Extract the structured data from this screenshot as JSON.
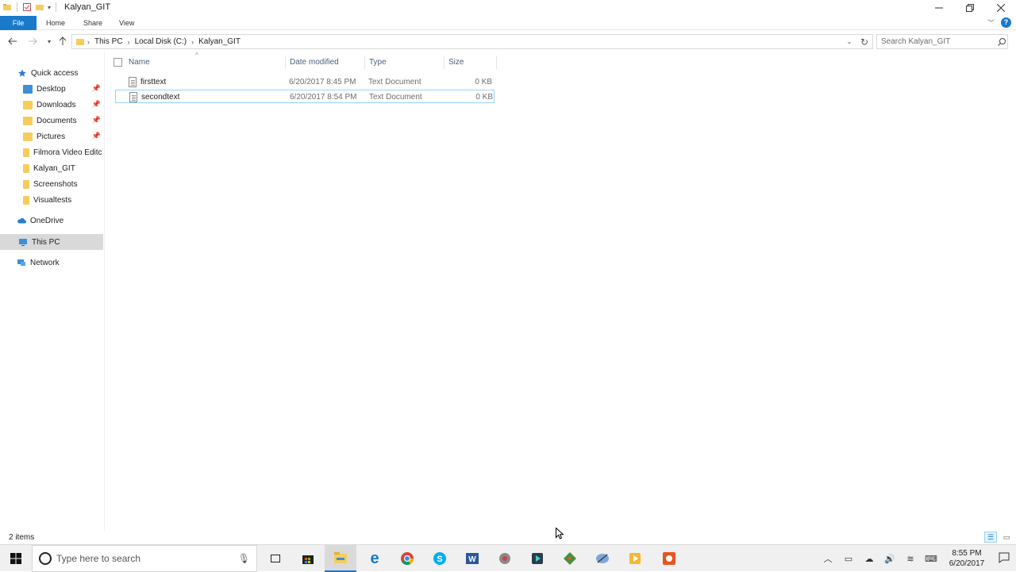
{
  "window": {
    "title": "Kalyan_GIT",
    "controls": [
      "minimize",
      "restore",
      "close"
    ]
  },
  "ribbon": {
    "tabs": [
      "File",
      "Home",
      "Share",
      "View"
    ]
  },
  "address": {
    "crumbs": [
      "This PC",
      "Local Disk (C:)",
      "Kalyan_GIT"
    ],
    "search_placeholder": "Search Kalyan_GIT"
  },
  "nav": {
    "quick_access": "Quick access",
    "items": [
      {
        "label": "Desktop",
        "pinned": true,
        "icon": "desktop-folder-icon"
      },
      {
        "label": "Downloads",
        "pinned": true,
        "icon": "downloads-folder-icon"
      },
      {
        "label": "Documents",
        "pinned": true,
        "icon": "documents-folder-icon"
      },
      {
        "label": "Pictures",
        "pinned": true,
        "icon": "pictures-folder-icon"
      },
      {
        "label": "Filmora Video Editc",
        "pinned": false,
        "icon": "folder-icon"
      },
      {
        "label": "Kalyan_GIT",
        "pinned": false,
        "icon": "folder-icon"
      },
      {
        "label": "Screenshots",
        "pinned": false,
        "icon": "folder-icon"
      },
      {
        "label": "Visualtests",
        "pinned": false,
        "icon": "folder-icon"
      }
    ],
    "onedrive": "OneDrive",
    "this_pc": "This PC",
    "network": "Network"
  },
  "columns": {
    "name": "Name",
    "date": "Date modified",
    "type": "Type",
    "size": "Size"
  },
  "files": [
    {
      "name": "firsttext",
      "date": "6/20/2017 8:45 PM",
      "type": "Text Document",
      "size": "0 KB",
      "selected": false
    },
    {
      "name": "secondtext",
      "date": "6/20/2017 8:54 PM",
      "type": "Text Document",
      "size": "0 KB",
      "selected": true
    }
  ],
  "status": {
    "items_count": "2 items"
  },
  "taskbar": {
    "search_placeholder": "Type here to search",
    "time": "8:55 PM",
    "date": "6/20/2017",
    "apps": [
      "task-view-icon",
      "store-icon",
      "file-explorer-icon",
      "edge-icon",
      "chrome-icon",
      "skype-icon",
      "word-icon",
      "app-icon",
      "filmora-icon",
      "git-icon",
      "app2-icon",
      "media-icon",
      "recorder-icon"
    ]
  },
  "colors": {
    "accent": "#1979ca",
    "folder": "#f6cd5b",
    "selection_border": "#99d1ff"
  }
}
